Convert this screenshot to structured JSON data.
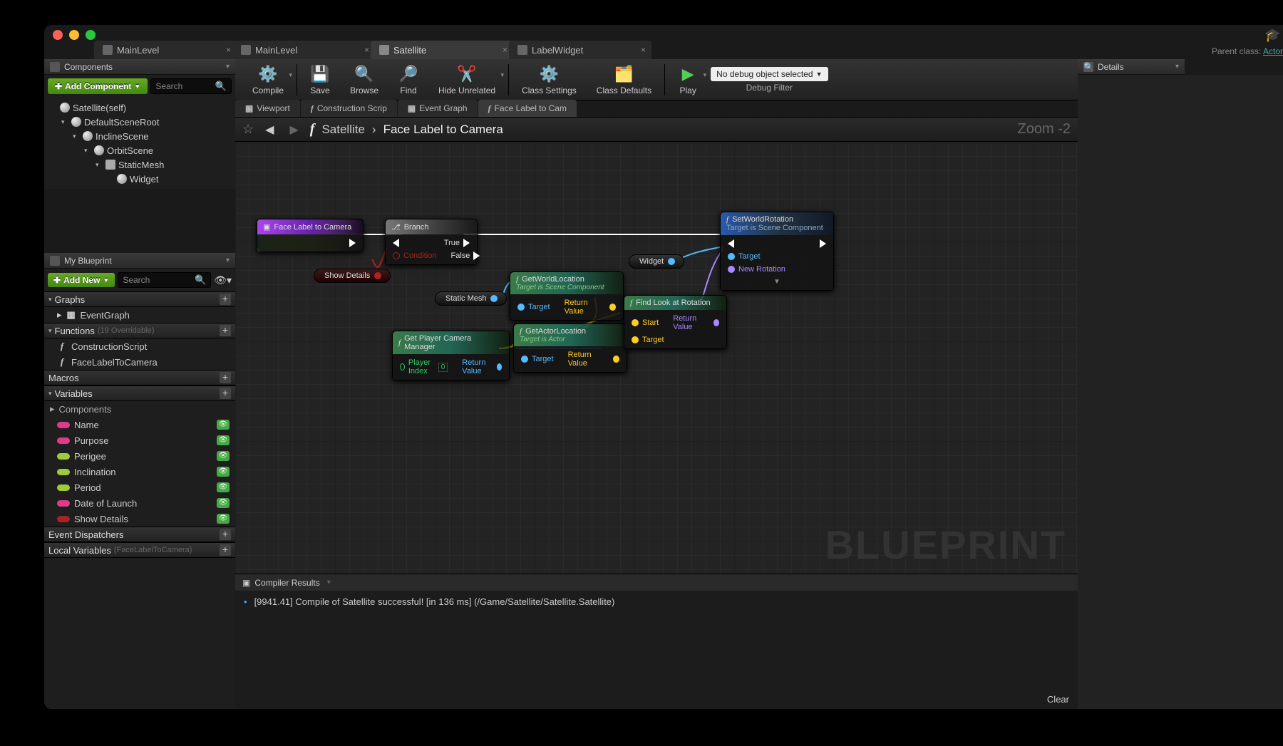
{
  "parent_class_label": "Parent class:",
  "parent_class_link": "Actor",
  "tabs": [
    {
      "label": "MainLevel",
      "active": false
    },
    {
      "label": "MainLevel",
      "active": false
    },
    {
      "label": "Satellite",
      "active": true
    },
    {
      "label": "LabelWidget",
      "active": false
    }
  ],
  "components": {
    "title": "Components",
    "add_label": "Add Component",
    "search_ph": "Search",
    "tree": [
      {
        "label": "Satellite(self)",
        "indent": 0,
        "tw": "",
        "icon": "sphere"
      },
      {
        "label": "DefaultSceneRoot",
        "indent": 1,
        "tw": "▾",
        "icon": "sphere"
      },
      {
        "label": "InclineScene",
        "indent": 2,
        "tw": "▾",
        "icon": "sphere"
      },
      {
        "label": "OrbitScene",
        "indent": 3,
        "tw": "▾",
        "icon": "sphere"
      },
      {
        "label": "StaticMesh",
        "indent": 4,
        "tw": "▾",
        "icon": "cube"
      },
      {
        "label": "Widget",
        "indent": 5,
        "tw": "",
        "icon": "sphere"
      }
    ]
  },
  "mybp": {
    "title": "My Blueprint",
    "addnew": "Add New",
    "search_ph": "Search",
    "sections": {
      "graphs": {
        "label": "Graphs",
        "items": [
          {
            "label": "EventGraph",
            "icon": "graph"
          }
        ]
      },
      "functions": {
        "label": "Functions",
        "sub": "(19 Overridable)",
        "items": [
          {
            "label": "ConstructionScript",
            "icon": "f"
          },
          {
            "label": "FaceLabelToCamera",
            "icon": "f"
          }
        ]
      },
      "macros": {
        "label": "Macros",
        "items": []
      },
      "variables": {
        "label": "Variables",
        "sub_label": "Components",
        "items": [
          {
            "label": "Name",
            "color": "#e03a8a"
          },
          {
            "label": "Purpose",
            "color": "#e03a8a"
          },
          {
            "label": "Perigee",
            "color": "#9ccc3c"
          },
          {
            "label": "Inclination",
            "color": "#9ccc3c"
          },
          {
            "label": "Period",
            "color": "#9ccc3c"
          },
          {
            "label": "Date of Launch",
            "color": "#e03a8a"
          },
          {
            "label": "Show Details",
            "color": "#aa2222"
          }
        ]
      },
      "dispatchers": {
        "label": "Event Dispatchers"
      },
      "locals": {
        "label": "Local Variables",
        "sub": "(FaceLabelToCamera)"
      }
    }
  },
  "toolbar": {
    "compile": "Compile",
    "save": "Save",
    "browse": "Browse",
    "find": "Find",
    "hide": "Hide Unrelated",
    "settings": "Class Settings",
    "defaults": "Class Defaults",
    "play": "Play",
    "debug_selected": "No debug object selected",
    "debug_filter": "Debug Filter"
  },
  "graph_tabs": [
    {
      "label": "Viewport",
      "icon": "vp"
    },
    {
      "label": "Construction Scrip",
      "icon": "f"
    },
    {
      "label": "Event Graph",
      "icon": "eg"
    },
    {
      "label": "Face Label to Cam",
      "icon": "f",
      "active": true
    }
  ],
  "crumbs": {
    "root": "Satellite",
    "leaf": "Face Label to Camera",
    "zoom": "Zoom -2"
  },
  "watermark": "BLUEPRINT",
  "nodes": {
    "entry": {
      "title": "Face Label to Camera"
    },
    "branch": {
      "title": "Branch",
      "cond": "Condition",
      "t": "True",
      "f": "False"
    },
    "showdet": {
      "title": "Show Details"
    },
    "getworldloc": {
      "title": "GetWorldLocation",
      "sub": "Target is Scene Component",
      "target": "Target",
      "ret": "Return Value"
    },
    "getactorloc": {
      "title": "GetActorLocation",
      "sub": "Target is Actor",
      "target": "Target",
      "ret": "Return Value"
    },
    "findlook": {
      "title": "Find Look at Rotation",
      "start": "Start",
      "target": "Target",
      "ret": "Return Value"
    },
    "setrot": {
      "title": "SetWorldRotation",
      "sub": "Target is Scene Component",
      "target": "Target",
      "newrot": "New Rotation"
    },
    "getcam": {
      "title": "Get Player Camera Manager",
      "player": "Player Index",
      "pidx": "0",
      "ret": "Return Value"
    },
    "staticmesh": "Static Mesh",
    "widget": "Widget"
  },
  "results": {
    "title": "Compiler Results",
    "line": "[9941.41] Compile of Satellite successful! [in 136 ms] (/Game/Satellite/Satellite.Satellite)",
    "clear": "Clear"
  },
  "details": {
    "title": "Details"
  }
}
